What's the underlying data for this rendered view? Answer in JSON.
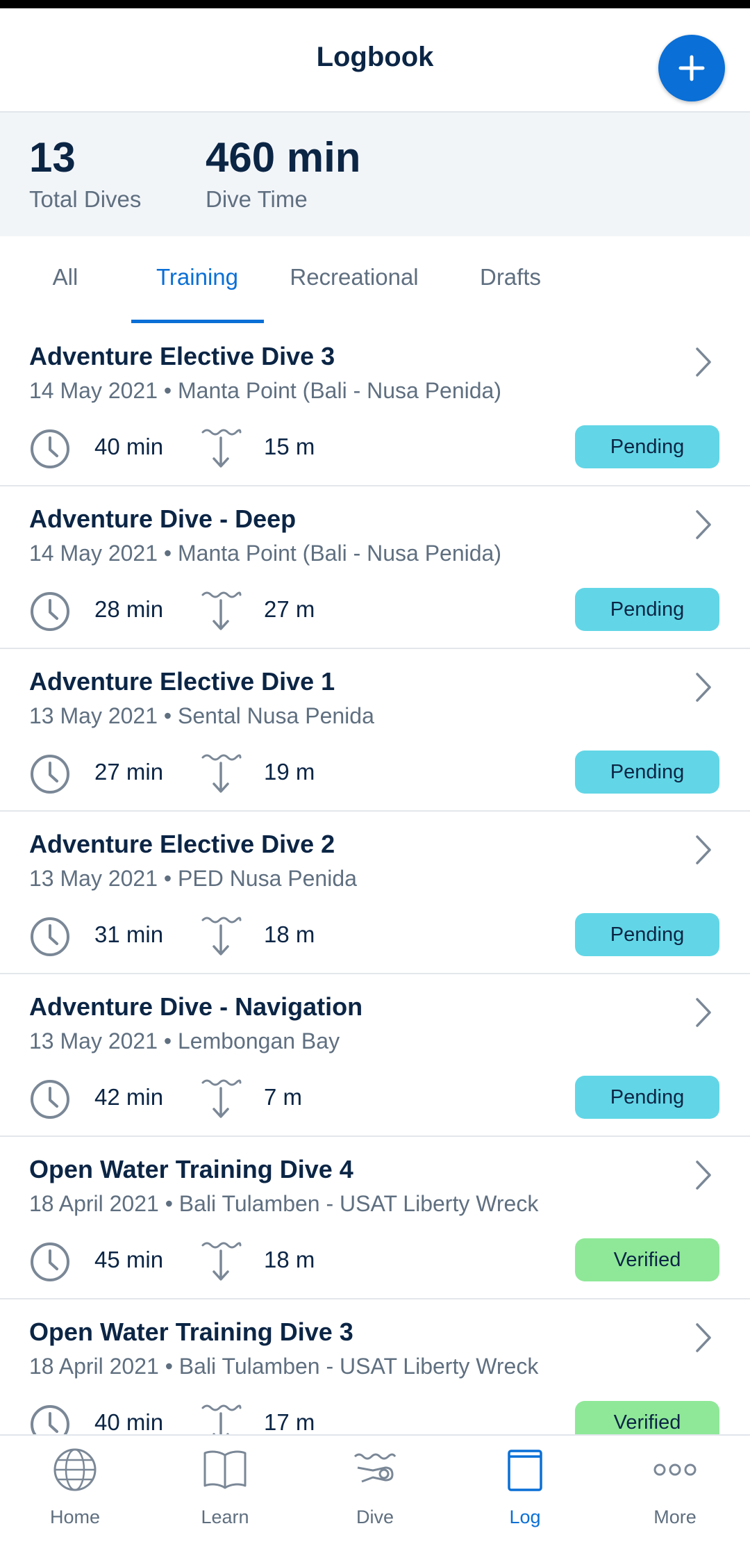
{
  "header": {
    "title": "Logbook"
  },
  "summary": {
    "total_dives_value": "13",
    "total_dives_label": "Total Dives",
    "dive_time_value": "460 min",
    "dive_time_label": "Dive Time"
  },
  "tabs": [
    {
      "label": "All"
    },
    {
      "label": "Training"
    },
    {
      "label": "Recreational"
    },
    {
      "label": "Drafts"
    }
  ],
  "active_tab": "Training",
  "dives": [
    {
      "title": "Adventure Elective Dive 3",
      "subtitle": "14 May 2021 • Manta Point (Bali - Nusa Penida)",
      "duration": "40 min",
      "depth": "15 m",
      "status": "Pending"
    },
    {
      "title": "Adventure Dive - Deep",
      "subtitle": "14 May 2021 • Manta Point (Bali - Nusa Penida)",
      "duration": "28 min",
      "depth": "27 m",
      "status": "Pending"
    },
    {
      "title": "Adventure Elective Dive 1",
      "subtitle": "13 May 2021 • Sental Nusa Penida",
      "duration": "27 min",
      "depth": "19 m",
      "status": "Pending"
    },
    {
      "title": "Adventure Elective Dive 2",
      "subtitle": "13 May 2021 • PED Nusa Penida",
      "duration": "31 min",
      "depth": "18 m",
      "status": "Pending"
    },
    {
      "title": "Adventure Dive - Navigation",
      "subtitle": "13 May 2021 • Lembongan Bay",
      "duration": "42 min",
      "depth": "7 m",
      "status": "Pending"
    },
    {
      "title": "Open Water Training Dive 4",
      "subtitle": "18 April 2021 • Bali Tulamben - USAT Liberty Wreck",
      "duration": "45 min",
      "depth": "18 m",
      "status": "Verified"
    },
    {
      "title": "Open Water Training Dive 3",
      "subtitle": "18 April 2021 • Bali Tulamben - USAT Liberty Wreck",
      "duration": "40 min",
      "depth": "17 m",
      "status": "Verified"
    }
  ],
  "nav": [
    {
      "label": "Home",
      "icon": "globe-icon"
    },
    {
      "label": "Learn",
      "icon": "book-icon"
    },
    {
      "label": "Dive",
      "icon": "diver-icon"
    },
    {
      "label": "Log",
      "icon": "logbook-icon"
    },
    {
      "label": "More",
      "icon": "more-dots-icon"
    }
  ],
  "active_nav": "Log",
  "colors": {
    "accent": "#0a6fd6",
    "pending": "#62d6e6",
    "verified": "#8fe898",
    "text_dark": "#0b2545",
    "text_muted": "#5f6f80"
  }
}
